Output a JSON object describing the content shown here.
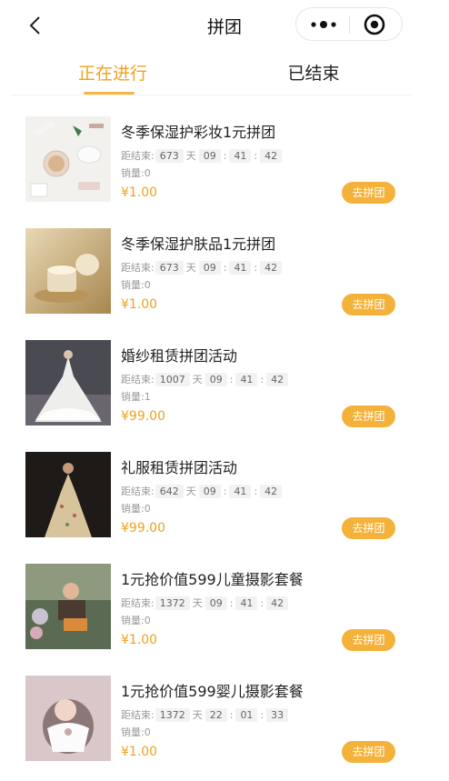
{
  "nav": {
    "title": "拼团",
    "back_icon": "chevron-left-icon",
    "more_icon": "more-dots-icon",
    "close_icon": "target-circle-icon"
  },
  "tabs": [
    {
      "label": "正在进行",
      "active": true
    },
    {
      "label": "已结束",
      "active": false
    }
  ],
  "colors": {
    "accent": "#f0a21e",
    "button": "#f5b23a"
  },
  "countdown_prefix": "距结束:",
  "day_unit": "天",
  "sales_prefix": "销量:",
  "join_label": "去拼团",
  "items": [
    {
      "title": "冬季保湿护彩妆1元拼团",
      "days": "673",
      "h": "09",
      "m": "41",
      "s": "42",
      "sales": "0",
      "price": "¥1.00"
    },
    {
      "title": "冬季保湿护肤品1元拼团",
      "days": "673",
      "h": "09",
      "m": "41",
      "s": "42",
      "sales": "0",
      "price": "¥1.00"
    },
    {
      "title": "婚纱租赁拼团活动",
      "days": "1007",
      "h": "09",
      "m": "41",
      "s": "42",
      "sales": "1",
      "price": "¥99.00"
    },
    {
      "title": "礼服租赁拼团活动",
      "days": "642",
      "h": "09",
      "m": "41",
      "s": "42",
      "sales": "0",
      "price": "¥99.00"
    },
    {
      "title": "1元抢价值599儿童摄影套餐",
      "days": "1372",
      "h": "09",
      "m": "41",
      "s": "42",
      "sales": "0",
      "price": "¥1.00"
    },
    {
      "title": "1元抢价值599婴儿摄影套餐",
      "days": "1372",
      "h": "22",
      "m": "01",
      "s": "33",
      "sales": "0",
      "price": "¥1.00"
    }
  ]
}
